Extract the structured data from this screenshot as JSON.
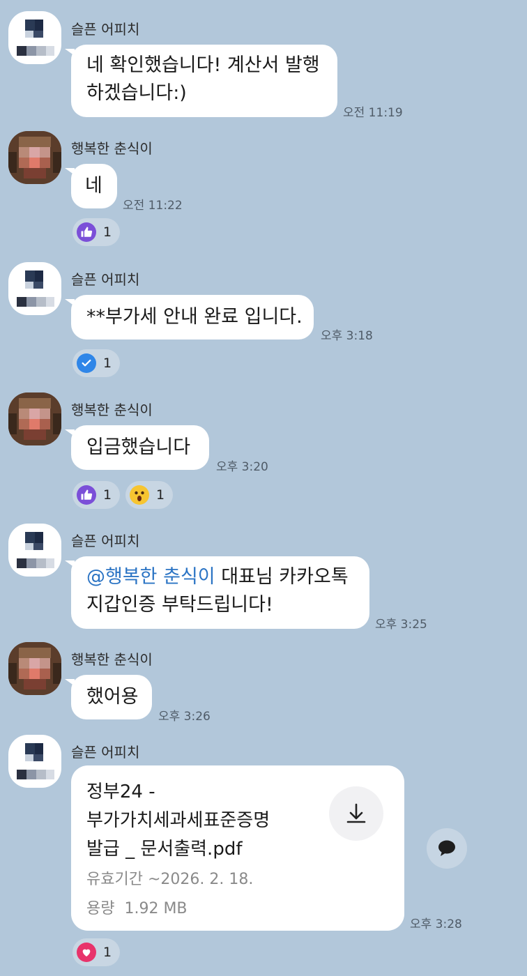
{
  "chat": {
    "messages": [
      {
        "sender": "슬픈 어피치",
        "text": "네 확인했습니다! 계산서 발행",
        "text2": "하겠습니다:)",
        "time": "오전 11:19"
      },
      {
        "sender": "행복한 춘식이",
        "text": "네",
        "time": "오전 11:22",
        "reactions": [
          {
            "icon": "thumbs-up-icon",
            "count": "1"
          }
        ]
      },
      {
        "sender": "슬픈 어피치",
        "text": "**부가세 안내 완료 입니다.",
        "time": "오후 3:18",
        "reactions": [
          {
            "icon": "check-icon",
            "count": "1"
          }
        ]
      },
      {
        "sender": "행복한 춘식이",
        "text": "입금했습니다",
        "time": "오후 3:20",
        "reactions": [
          {
            "icon": "thumbs-up-icon",
            "count": "1"
          },
          {
            "icon": "surprised-face-icon",
            "count": "1"
          }
        ]
      },
      {
        "sender": "슬픈 어피치",
        "mention": "@행복한 춘식이",
        "text": " 대표님 카카오톡",
        "text2": "지갑인증 부탁드립니다!",
        "time": "오후 3:25"
      },
      {
        "sender": "행복한 춘식이",
        "text": "했어용",
        "time": "오후 3:26"
      },
      {
        "sender": "슬픈 어피치",
        "time": "오후 3:28",
        "reactions": [
          {
            "icon": "heart-icon",
            "count": "1"
          }
        ]
      }
    ],
    "file": {
      "name_line1": "정부24 -",
      "name_line2": "부가가치세과세표준증명",
      "name_line3": "발급 _ 문서출력.pdf",
      "expiry": "유효기간 ~2026. 2. 18.",
      "size": "용량  1.92 MB",
      "download_icon": "download-icon",
      "share_icon": "speech-bubble-icon"
    }
  },
  "colors": {
    "background": "#b2c7da",
    "bubble": "#ffffff",
    "mention": "#2b74c4",
    "thumbs": "#7b4fd8",
    "check": "#2f86e8",
    "heart": "#e8336b"
  }
}
